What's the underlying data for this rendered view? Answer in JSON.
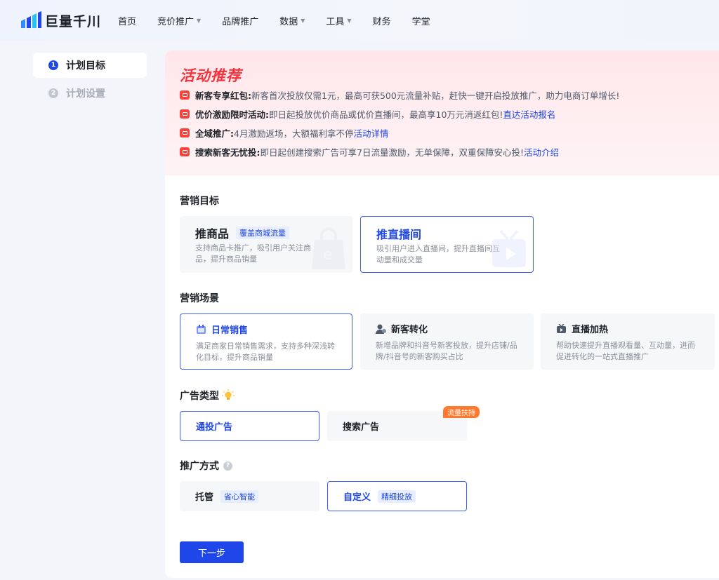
{
  "header": {
    "logo_text": "巨量千川",
    "nav": [
      {
        "label": "首页",
        "has_dropdown": false
      },
      {
        "label": "竞价推广",
        "has_dropdown": true
      },
      {
        "label": "品牌推广",
        "has_dropdown": false
      },
      {
        "label": "数据",
        "has_dropdown": true
      },
      {
        "label": "工具",
        "has_dropdown": true
      },
      {
        "label": "财务",
        "has_dropdown": false
      },
      {
        "label": "学堂",
        "has_dropdown": false
      }
    ]
  },
  "steps": [
    {
      "num": "1",
      "label": "计划目标",
      "active": true
    },
    {
      "num": "2",
      "label": "计划设置",
      "active": false
    }
  ],
  "promo": {
    "title": "活动推荐",
    "items": [
      {
        "key": "新客专享红包:",
        "text": " 新客首次投放仅需1元，最高可获500元流量补贴，赶快一键开启投放推广，助力电商订单增长!",
        "link": ""
      },
      {
        "key": "优价激励限时活动:",
        "text": " 即日起投放优价商品或优价直播间，最高享10万元消返红包! ",
        "link": "直达活动报名"
      },
      {
        "key": "全域推广:",
        "text": " 4月激励返场，大额福利拿不停",
        "link": "活动详情"
      },
      {
        "key": "搜索新客无忧投:",
        "text": " 即日起创建搜索广告可享7日流量激励，无单保障，双重保障安心投! ",
        "link": "活动介绍"
      }
    ]
  },
  "marketing_goal": {
    "title": "营销目标",
    "options": [
      {
        "title": "推商品",
        "tag": "覆盖商城流量",
        "desc": "支持商品卡推广，吸引用户关注商品，提升商品销量",
        "selected": false
      },
      {
        "title": "推直播间",
        "tag": "",
        "desc": "吸引用户进入直播间，提升直播间互动量和成交量",
        "selected": true
      }
    ]
  },
  "marketing_scene": {
    "title": "营销场景",
    "options": [
      {
        "title": "日常销售",
        "icon": "calendar-icon",
        "desc": "满足商家日常销售需求，支持多种深浅转化目标，提升商品销量",
        "selected": true
      },
      {
        "title": "新客转化",
        "icon": "new-user-icon",
        "desc": "新增品牌和抖音号新客投放，提升店铺/品牌/抖音号的新客购买占比",
        "selected": false
      },
      {
        "title": "直播加热",
        "icon": "live-tv-icon",
        "desc": "帮助快速提升直播观看量、互动量，进而促进转化的一站式直播推广",
        "selected": false
      }
    ]
  },
  "ad_type": {
    "title": "广告类型",
    "options": [
      {
        "label": "通投广告",
        "selected": true
      },
      {
        "label": "搜索广告",
        "selected": false,
        "badge": "流量扶持"
      }
    ]
  },
  "promo_method": {
    "title": "推广方式",
    "help": "?",
    "options": [
      {
        "label": "托管",
        "tag": "省心智能",
        "selected": false
      },
      {
        "label": "自定义",
        "tag": "精细投放",
        "selected": true
      }
    ]
  },
  "next_button": "下一步",
  "colors": {
    "primary": "#1e46e8",
    "promo_red": "#f6323a",
    "badge_orange": "#ff7a2e"
  }
}
